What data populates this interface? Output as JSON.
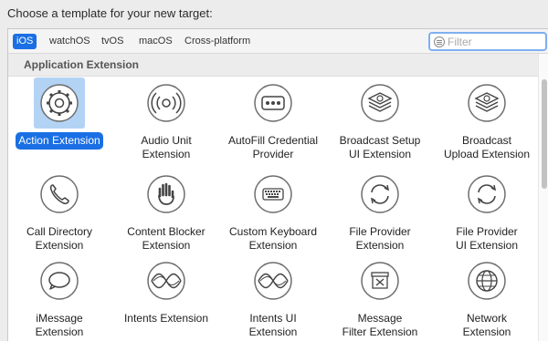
{
  "prompt": "Choose a template for your new target:",
  "tabs": [
    {
      "label": "iOS"
    },
    {
      "label": "watchOS"
    },
    {
      "label": "tvOS"
    },
    {
      "label": "macOS"
    },
    {
      "label": "Cross-platform"
    }
  ],
  "filter": {
    "placeholder": "Filter"
  },
  "section": {
    "title": "Application Extension"
  },
  "items": [
    {
      "label": "Action Extension",
      "icon": "gear-icon"
    },
    {
      "label": "Audio Unit\nExtension",
      "icon": "audio-wave-icon"
    },
    {
      "label": "AutoFill Credential\nProvider",
      "icon": "password-icon"
    },
    {
      "label": "Broadcast Setup\nUI Extension",
      "icon": "broadcast-icon"
    },
    {
      "label": "Broadcast\nUpload Extension",
      "icon": "broadcast-icon"
    },
    {
      "label": "Call Directory\nExtension",
      "icon": "phone-icon"
    },
    {
      "label": "Content Blocker\nExtension",
      "icon": "hand-icon"
    },
    {
      "label": "Custom Keyboard\nExtension",
      "icon": "keyboard-icon"
    },
    {
      "label": "File Provider\nExtension",
      "icon": "sync-icon"
    },
    {
      "label": "File Provider\nUI Extension",
      "icon": "sync-icon"
    },
    {
      "label": "iMessage\nExtension",
      "icon": "message-icon"
    },
    {
      "label": "Intents Extension",
      "icon": "intents-icon"
    },
    {
      "label": "Intents UI\nExtension",
      "icon": "intents-icon"
    },
    {
      "label": "Message\nFilter Extension",
      "icon": "filter-tray-icon"
    },
    {
      "label": "Network\nExtension",
      "icon": "globe-icon"
    }
  ]
}
